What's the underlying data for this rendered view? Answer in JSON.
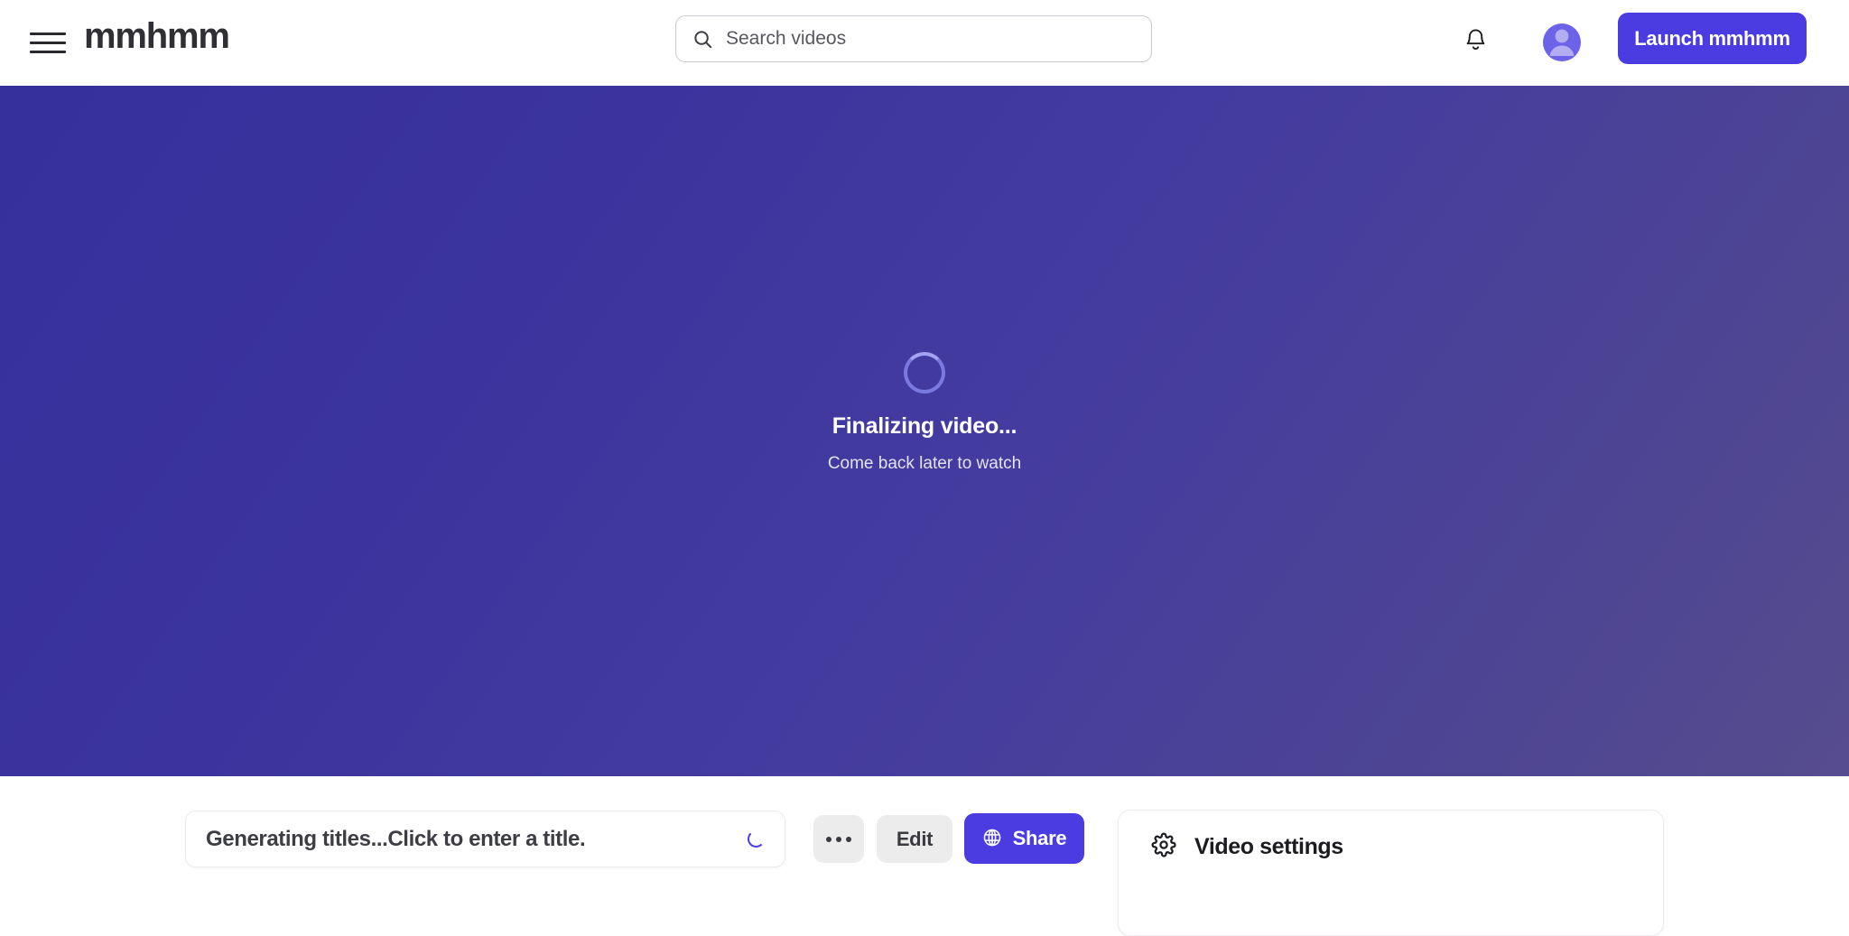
{
  "header": {
    "menu_icon": "hamburger-menu-icon",
    "brand": "mmhmm",
    "search": {
      "icon": "search-icon",
      "placeholder": "Search videos",
      "value": ""
    },
    "notifications_icon": "bell-icon",
    "avatar_icon": "user-avatar-icon",
    "launch_button": "Launch mmhmm"
  },
  "stage": {
    "spinner_icon": "loading-spinner-icon",
    "title": "Finalizing video...",
    "subtitle": "Come back later to watch"
  },
  "bottom": {
    "title_field": {
      "value": "Generating titles...Click to enter a title.",
      "spinner_icon": "inline-loading-spinner-icon"
    },
    "more_button": "•••",
    "more_icon": "ellipsis-icon",
    "edit_button": "Edit",
    "share_button": "Share",
    "share_icon": "globe-icon",
    "settings": {
      "icon": "gear-icon",
      "label": "Video settings"
    }
  },
  "colors": {
    "accent": "#4a3ce0",
    "stage_gradient_start": "#35309c",
    "stage_gradient_end": "#564c8e",
    "avatar_bg": "#6c63e8",
    "button_gray": "#ececec",
    "spinner": "#7a79df"
  }
}
